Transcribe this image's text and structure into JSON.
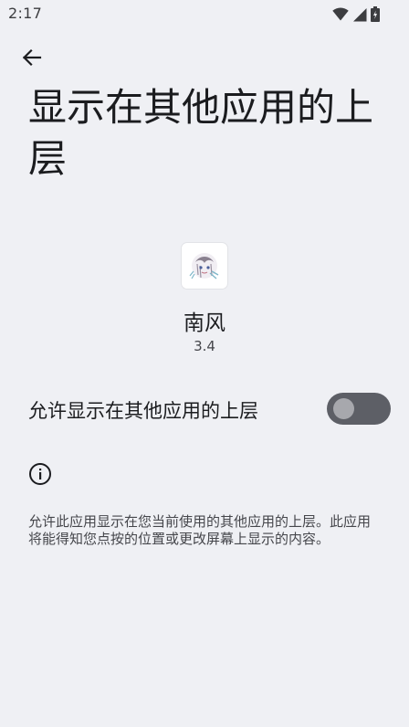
{
  "status_bar": {
    "time": "2:17",
    "icons": [
      "wifi-icon",
      "cellular-signal-icon",
      "battery-icon"
    ]
  },
  "header": {
    "back_icon": "arrow-back-icon",
    "title": "显示在其他应用的上层"
  },
  "app": {
    "name": "南风",
    "version": "3.4",
    "icon": "app-icon"
  },
  "permission": {
    "label": "允许显示在其他应用的上层",
    "enabled": false
  },
  "info": {
    "icon": "info-icon",
    "description": "允许此应用显示在您当前使用的其他应用的上层。此应用将能得知您点按的位置或更改屏幕上显示的内容。"
  },
  "colors": {
    "background": "#eff0f4",
    "text_primary": "#1b1c1f",
    "text_secondary": "#45464b",
    "toggle_track_off": "#5d5f66",
    "toggle_knob_off": "#a7a8ad"
  }
}
